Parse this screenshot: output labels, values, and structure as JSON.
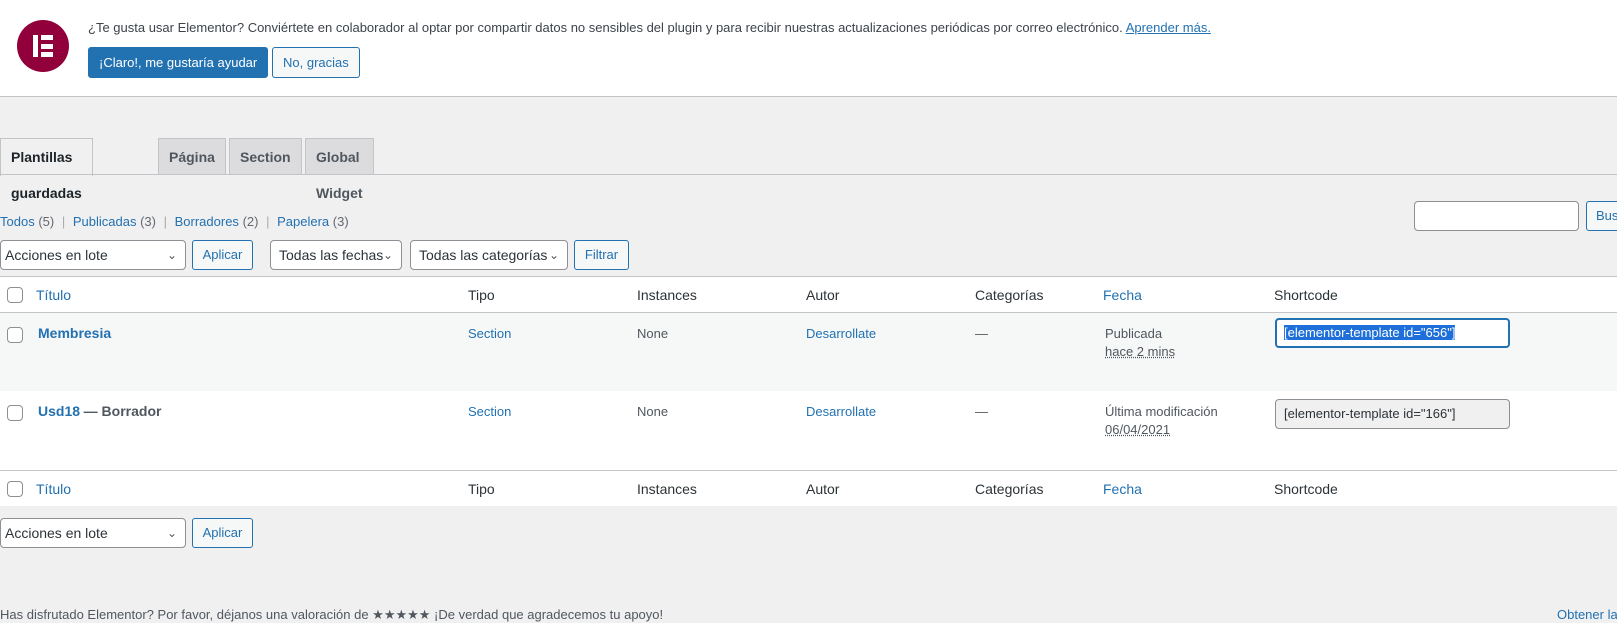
{
  "notice": {
    "message": "¿Te gusta usar Elementor? Conviértete en colaborador al optar por compartir datos no sensibles del plugin y para recibir nuestras actualizaciones periódicas por correo electrónico.",
    "learn_more": "Aprender más.",
    "accept_label": "¡Claro!, me gustaría ayudar",
    "decline_label": "No, gracias",
    "brand_color": "#92003b"
  },
  "tabs": [
    "Plantillas guardadas",
    "Página",
    "Section",
    "Global Widget"
  ],
  "filters": {
    "all": "Todos",
    "all_count": "(5)",
    "published": "Publicadas",
    "published_count": "(3)",
    "drafts": "Borradores",
    "drafts_count": "(2)",
    "trash": "Papelera",
    "trash_count": "(3)",
    "separator": "|"
  },
  "search": {
    "button_label": "Bus"
  },
  "toolbar": {
    "bulk_actions": "Acciones en lote",
    "apply": "Aplicar",
    "dates": "Todas las fechas",
    "categories": "Todas las categorías",
    "filter": "Filtrar"
  },
  "columns": {
    "title": "Título",
    "type": "Tipo",
    "instances": "Instances",
    "author": "Autor",
    "categories": "Categorías",
    "date": "Fecha",
    "shortcode": "Shortcode"
  },
  "rows": [
    {
      "title": "Membresia",
      "state": "",
      "type": "Section",
      "instances": "None",
      "author": "Desarrollate",
      "categories": "—",
      "date_status": "Publicada",
      "date_value": "hace 2 mins",
      "shortcode": "[elementor-template id=\"656\"]"
    },
    {
      "title": "Usd18",
      "state": "— Borrador",
      "type": "Section",
      "instances": "None",
      "author": "Desarrollate",
      "categories": "—",
      "date_status": "Última modificación",
      "date_value": "06/04/2021",
      "shortcode": "[elementor-template id=\"166\"]"
    }
  ],
  "footer": {
    "text": "Has disfrutado Elementor? Por favor, déjanos una valoración de ★★★★★ ¡De verdad que agradecemos tu apoyo!",
    "right_link": "Obtener la"
  }
}
